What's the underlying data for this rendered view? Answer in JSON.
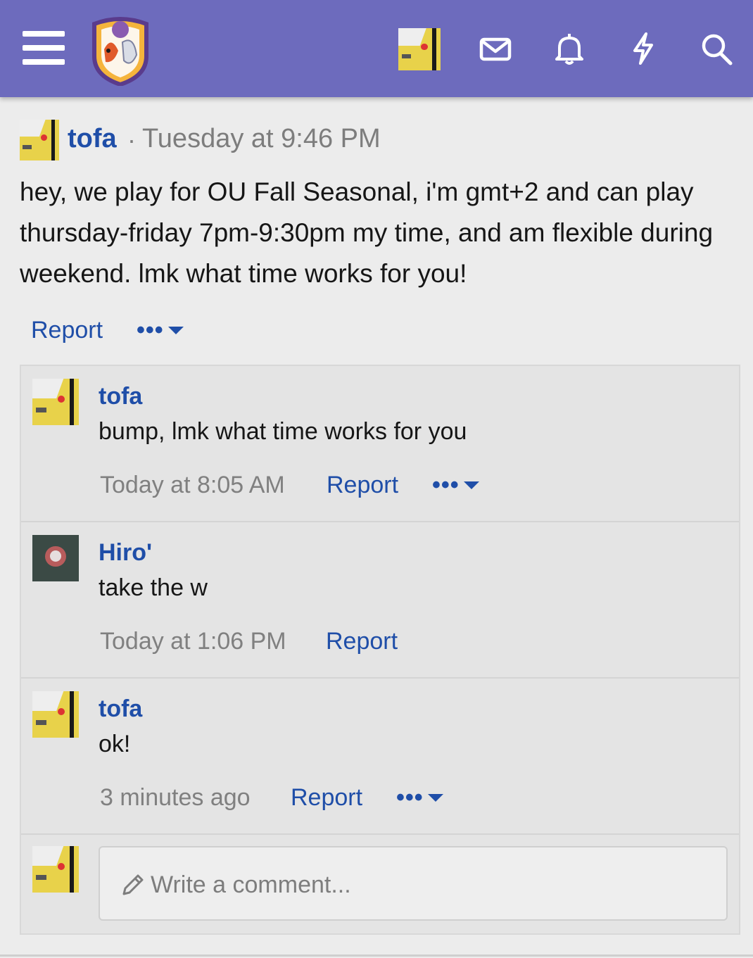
{
  "header": {
    "menu_icon": "hamburger-icon",
    "logo_icon": "site-crest-logo",
    "icons": [
      "mail-icon",
      "bell-icon",
      "lightning-icon",
      "search-icon"
    ],
    "bg_color": "#6d6bbd"
  },
  "post": {
    "author": "tofa",
    "separator": "·",
    "time": "Tuesday at 9:46 PM",
    "body": "hey, we play for OU Fall Seasonal, i'm gmt+2 and can play thursday-friday 7pm-9:30pm my time, and am flexible during weekend. lmk what time works for you!",
    "report_label": "Report",
    "more_label": "•••"
  },
  "comments": [
    {
      "author": "tofa",
      "text": "bump, lmk what time works for you",
      "time": "Today at 8:05 AM",
      "report_label": "Report",
      "more_label": "•••"
    },
    {
      "author": "Hiro'",
      "text": "take the w",
      "time": "Today at 1:06 PM",
      "report_label": "Report"
    },
    {
      "author": "tofa",
      "text": "ok!",
      "time": "3 minutes ago",
      "report_label": "Report",
      "more_label": "•••"
    }
  ],
  "reply": {
    "placeholder": "Write a comment...",
    "icon": "pencil-icon"
  },
  "colors": {
    "accent": "#1f4ea8",
    "muted": "#7d7d7d"
  }
}
